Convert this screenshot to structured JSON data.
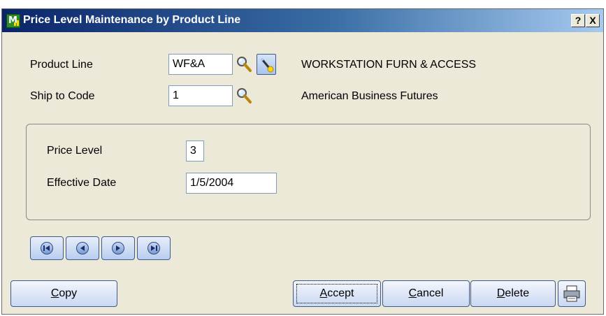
{
  "window": {
    "title": "Price Level Maintenance by Product Line",
    "help_label": "?",
    "close_label": "X"
  },
  "form": {
    "product_line": {
      "label": "Product Line",
      "value": "WF&A",
      "description": "WORKSTATION FURN & ACCESS"
    },
    "ship_to_code": {
      "label": "Ship to Code",
      "value": "1",
      "description": "American Business Futures"
    },
    "price_level": {
      "label": "Price Level",
      "value": "3"
    },
    "effective_date": {
      "label": "Effective Date",
      "value": "1/5/2004"
    }
  },
  "buttons": {
    "copy": {
      "mnemonic": "C",
      "rest": "opy"
    },
    "accept": {
      "mnemonic": "A",
      "rest": "ccept"
    },
    "cancel": {
      "mnemonic": "C",
      "rest": "ancel"
    },
    "delete": {
      "mnemonic": "D",
      "rest": "elete"
    }
  },
  "icons": {
    "lookup": "magnifier-icon",
    "wizard": "magic-wand-icon",
    "nav": [
      "first-record-icon",
      "previous-record-icon",
      "next-record-icon",
      "last-record-icon"
    ],
    "print": "printer-icon"
  },
  "colors": {
    "titlebar_start": "#0a246a",
    "titlebar_end": "#a6caf0",
    "dialog_bg": "#ece9d8",
    "button_border": "#3d5a8a"
  }
}
